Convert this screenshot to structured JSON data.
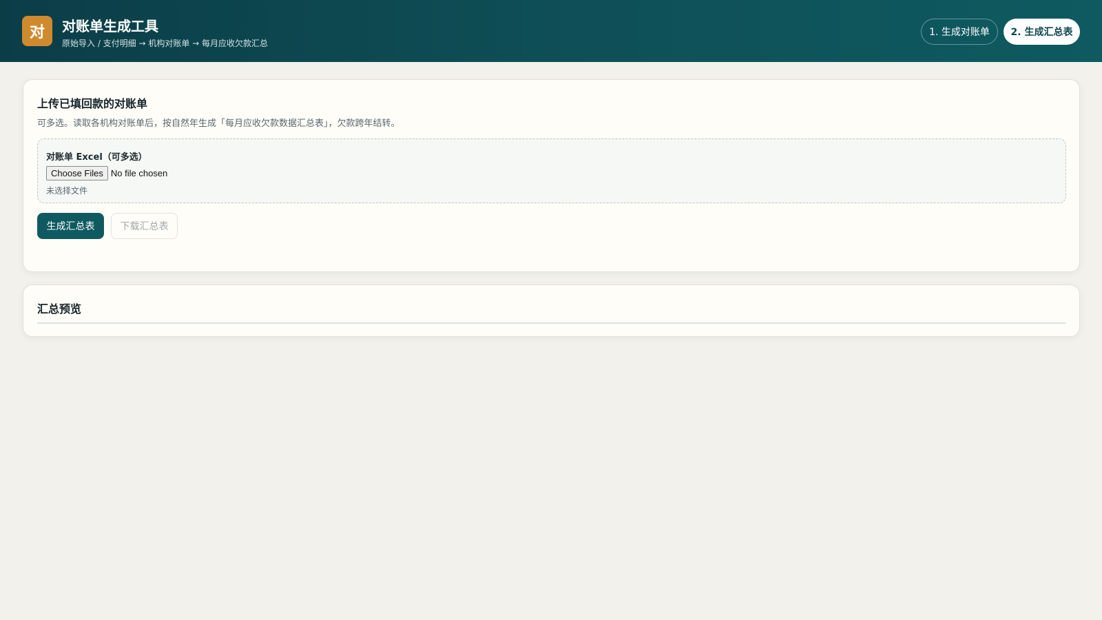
{
  "header": {
    "logo_text": "对",
    "title": "对账单生成工具",
    "subtitle": "原始导入 / 支付明细 → 机构对账单 → 每月应收欠款汇总",
    "steps": [
      {
        "label": "1. 生成对账单",
        "active": false
      },
      {
        "label": "2. 生成汇总表",
        "active": true
      }
    ]
  },
  "upload": {
    "title": "上传已填回款的对账单",
    "description": "可多选。读取各机构对账单后，按自然年生成「每月应收欠款数据汇总表」，欠款跨年结转。",
    "field_label": "对账单 Excel（可多选）",
    "choose_button": "Choose Files",
    "no_file_text": "No file chosen",
    "hint": "未选择文件",
    "generate_button": "生成汇总表",
    "download_button": "下载汇总表"
  },
  "preview": {
    "title": "汇总预览"
  },
  "colors": {
    "header_bg": "#0f5058",
    "logo_bg": "#d08a2e",
    "primary": "#0f5a60",
    "page_bg": "#f3f1ec"
  }
}
